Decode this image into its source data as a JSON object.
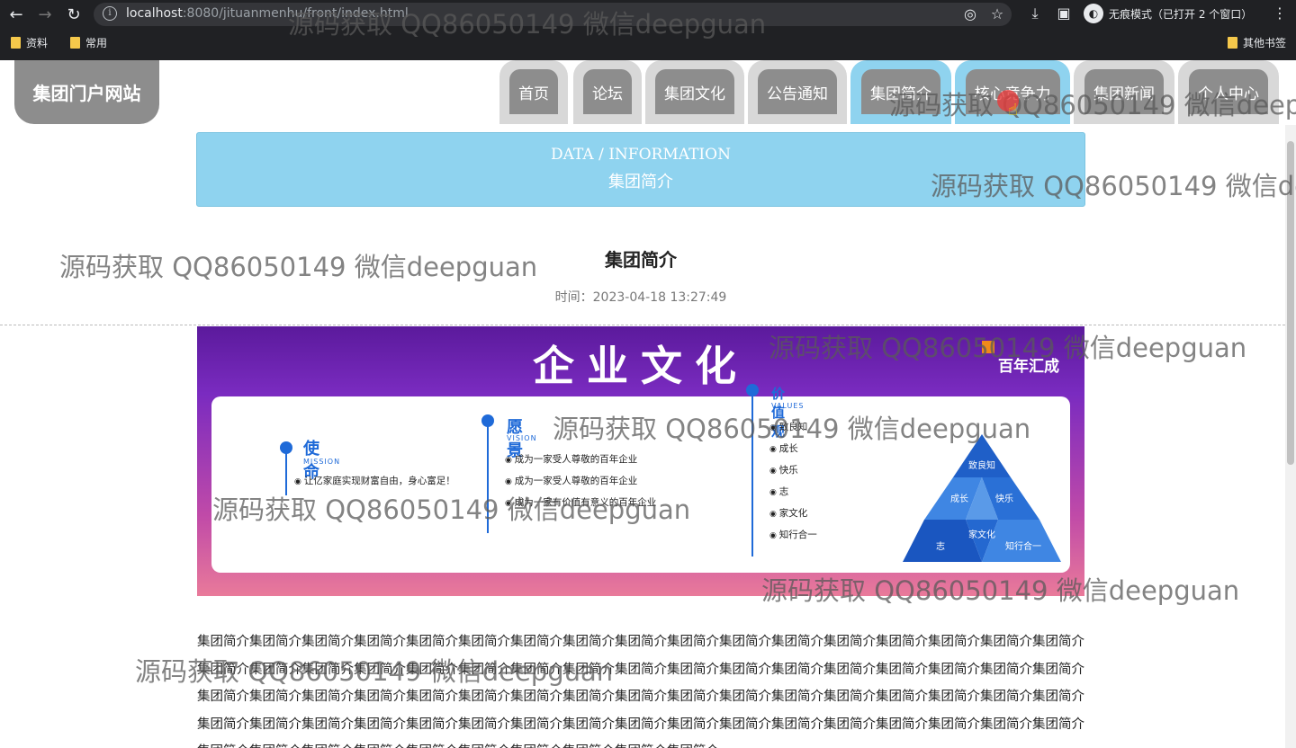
{
  "browser": {
    "url_host": "localhost",
    "url_rest": ":8080/jituanmenhu/front/index.html",
    "incognito_label": "无痕模式（已打开 2 个窗口）",
    "bookmarks": [
      {
        "label": "资料"
      },
      {
        "label": "常用"
      }
    ],
    "other_bookmarks": "其他书签"
  },
  "site": {
    "logo": "集团门户网站",
    "nav": [
      {
        "label": "首页",
        "active": false
      },
      {
        "label": "论坛",
        "active": false
      },
      {
        "label": "集团文化",
        "active": false
      },
      {
        "label": "公告通知",
        "active": false
      },
      {
        "label": "集团简介",
        "active": true
      },
      {
        "label": "核心竞争力",
        "active": true
      },
      {
        "label": "集团新闻",
        "active": false
      },
      {
        "label": "个人中心",
        "active": false
      }
    ]
  },
  "banner": {
    "en": "DATA / INFORMATION",
    "cn": "集团简介"
  },
  "article": {
    "title": "集团简介",
    "time": "时间：2023-04-18 13:27:49",
    "body": "集团简介集团简介集团简介集团简介集团简介集团简介集团简介集团简介集团简介集团简介集团简介集团简介集团简介集团简介集团简介集团简介集团简介集团简介集团简介集团简介集团简介集团简介集团简介集团简介集团简介集团简介集团简介集团简介集团简介集团简介集团简介集团简介集团简介集团简介集团简介集团简介集团简介集团简介集团简介集团简介集团简介集团简介集团简介集团简介集团简介集团简介集团简介集团简介集团简介集团简介集团简介集团简介集团简介集团简介集团简介集团简介集团简介集团简介集团简介集团简介集团简介集团简介集团简介集团简介集团简介集团简介集团简介集团简介集团简介集团简介集团简介集团简介集团简介集团简介集团简介集团简介集团简介集团简介"
  },
  "culture_image": {
    "heading": "企业文化",
    "brand": "百年汇成",
    "mission": {
      "title": "使命",
      "sub": "MISSION",
      "items": [
        "让亿家庭实现财富自由，身心富足！"
      ]
    },
    "vision": {
      "title": "愿景",
      "sub": "VISION",
      "items": [
        "成为一家受人尊敬的百年企业",
        "成为一家受人尊敬的百年企业",
        "成为一家有价值有意义的百年企业"
      ]
    },
    "values": {
      "title": "价值观",
      "sub": "VALUES",
      "items": [
        "致良知",
        "成长",
        "快乐",
        "志",
        "家文化",
        "知行合一"
      ]
    },
    "pyramid": {
      "top": "致良知",
      "mid_left": "成长",
      "mid_right": "快乐",
      "center": "家文化",
      "bottom_left": "志",
      "bottom_right": "知行合一"
    }
  },
  "watermark": "源码获取 QQ86050149 微信deepguan",
  "colors": {
    "accent": "#8fd3ef",
    "tab_inner": "#8d8d8d",
    "tab_outer": "#d8d8d8",
    "brand_blue": "#1f6ad8"
  }
}
